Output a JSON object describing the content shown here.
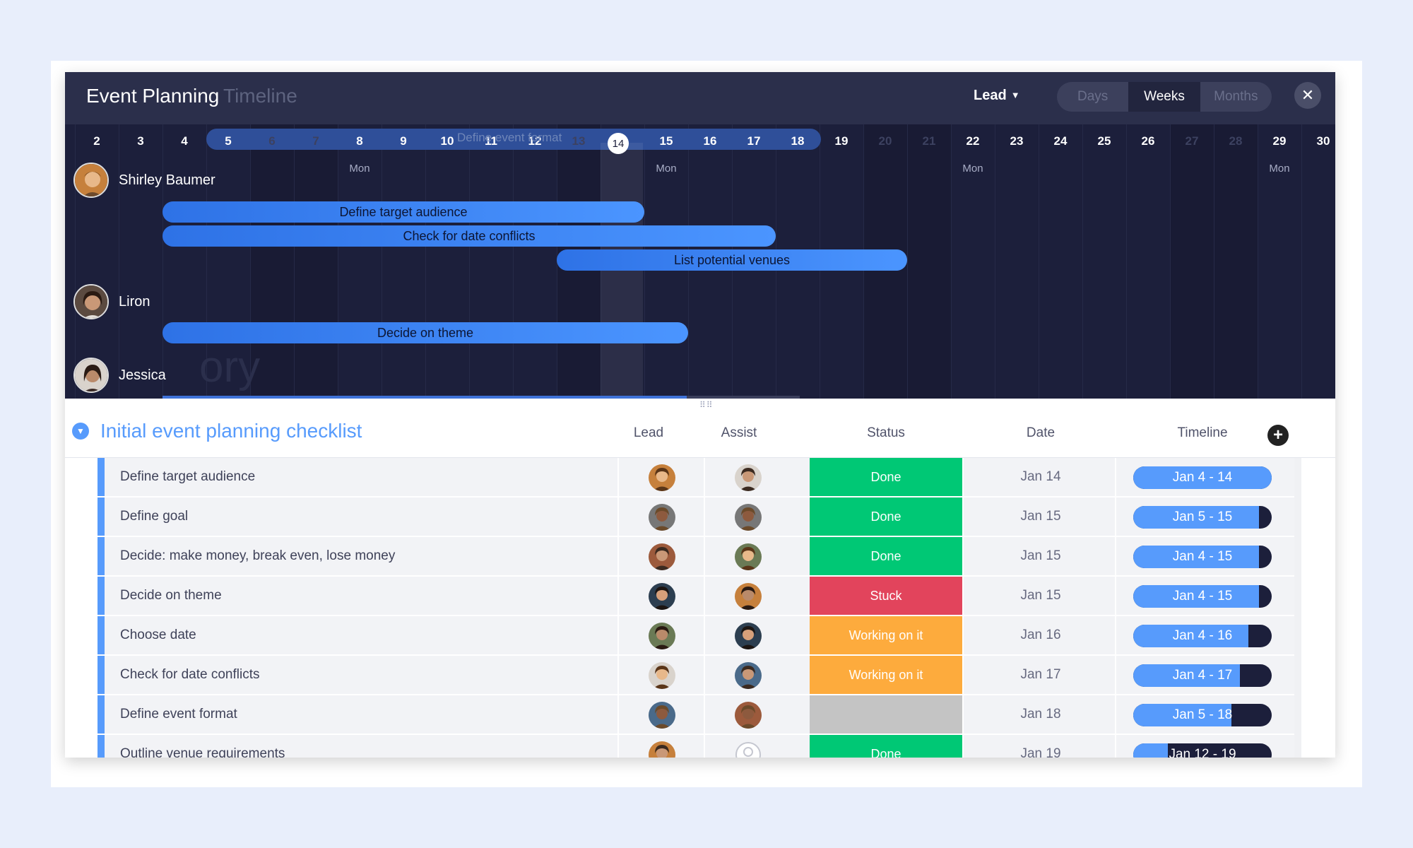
{
  "app": {
    "title": "Event Planning",
    "view": "Timeline"
  },
  "controls": {
    "lead_label": "Lead",
    "scale_options": [
      "Days",
      "Weeks",
      "Months"
    ],
    "selected_scale": "Weeks"
  },
  "timeline": {
    "days": [
      "2",
      "3",
      "4",
      "5",
      "6",
      "7",
      "8",
      "9",
      "10",
      "11",
      "12",
      "13",
      "14",
      "15",
      "16",
      "17",
      "18",
      "19",
      "20",
      "21",
      "22",
      "23",
      "24",
      "25",
      "26",
      "27",
      "28",
      "29",
      "30"
    ],
    "weekend_days": [
      "6",
      "7",
      "13",
      "20",
      "21",
      "27",
      "28"
    ],
    "today": "14",
    "mon_label": "Mon",
    "range_label": "Define event format",
    "people": [
      {
        "name": "Shirley Baumer",
        "tasks": [
          "Define target audience",
          "Check for date conflicts",
          "List potential venues"
        ]
      },
      {
        "name": "Liron",
        "tasks": [
          "Decide on theme"
        ]
      },
      {
        "name": "Jessica",
        "tasks": []
      }
    ],
    "ghost_text": "ory"
  },
  "board": {
    "group_title": "Initial event planning checklist",
    "columns": {
      "lead": "Lead",
      "assist": "Assist",
      "status": "Status",
      "date": "Date",
      "timeline": "Timeline"
    },
    "status_colors": {
      "Done": "#00c875",
      "Stuck": "#e2445c",
      "Working on it": "#fdab3d",
      "": "#c4c4c4"
    },
    "rows": [
      {
        "name": "Define target audience",
        "status": "Done",
        "date": "Jan 14",
        "timeline": "Jan 4 - 14",
        "progress": 1.0
      },
      {
        "name": "Define goal",
        "status": "Done",
        "date": "Jan 15",
        "timeline": "Jan 5 - 15",
        "progress": 0.91
      },
      {
        "name": "Decide: make money, break even, lose money",
        "status": "Done",
        "date": "Jan 15",
        "timeline": "Jan 4 - 15",
        "progress": 0.91
      },
      {
        "name": "Decide on theme",
        "status": "Stuck",
        "date": "Jan 15",
        "timeline": "Jan 4 - 15",
        "progress": 0.91
      },
      {
        "name": "Choose date",
        "status": "Working on it",
        "date": "Jan 16",
        "timeline": "Jan 4 - 16",
        "progress": 0.83
      },
      {
        "name": "Check for date conflicts",
        "status": "Working on it",
        "date": "Jan 17",
        "timeline": "Jan 4 - 17",
        "progress": 0.77
      },
      {
        "name": "Define event format",
        "status": "",
        "date": "Jan 18",
        "timeline": "Jan 5 - 18",
        "progress": 0.71
      },
      {
        "name": "Outline venue requirements",
        "status": "Done",
        "date": "Jan 19",
        "timeline": "Jan 12 - 19",
        "progress": 0.25
      }
    ]
  }
}
